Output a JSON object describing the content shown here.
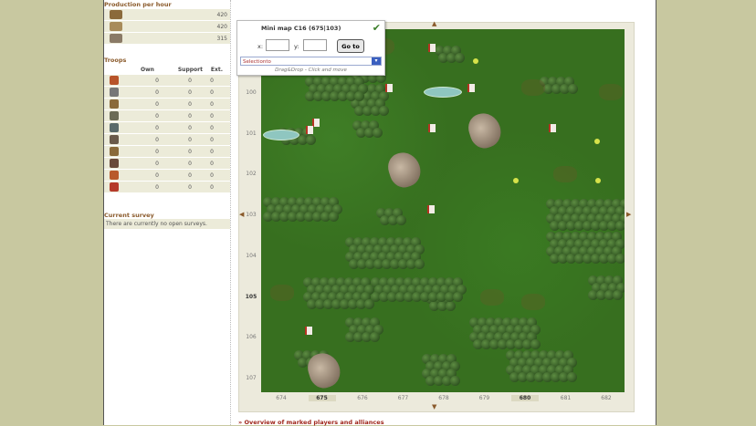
{
  "sidebar": {
    "production_title": "Production per hour",
    "resources": [
      {
        "icon": "wood-icon",
        "color": "#8b6a3b",
        "value": "420"
      },
      {
        "icon": "stone-icon",
        "color": "#a88b5a",
        "value": "420"
      },
      {
        "icon": "iron-icon",
        "color": "#8a7a66",
        "value": "315"
      }
    ],
    "troops_title": "Troops",
    "troop_columns": [
      "Own",
      "Support",
      "Ext."
    ],
    "troops": [
      {
        "icon": "spear-icon",
        "own": "0",
        "support": "0",
        "ext": "0"
      },
      {
        "icon": "sword-icon",
        "own": "0",
        "support": "0",
        "ext": "0"
      },
      {
        "icon": "axe-icon",
        "own": "0",
        "support": "0",
        "ext": "0"
      },
      {
        "icon": "archer-icon",
        "own": "0",
        "support": "0",
        "ext": "0"
      },
      {
        "icon": "scout-icon",
        "own": "0",
        "support": "0",
        "ext": "0"
      },
      {
        "icon": "light-cavalry-icon",
        "own": "0",
        "support": "0",
        "ext": "0"
      },
      {
        "icon": "ram-icon",
        "own": "0",
        "support": "0",
        "ext": "0"
      },
      {
        "icon": "catapult-icon",
        "own": "0",
        "support": "0",
        "ext": "0"
      },
      {
        "icon": "paladin-icon",
        "own": "0",
        "support": "0",
        "ext": "0"
      },
      {
        "icon": "noble-icon",
        "own": "0",
        "support": "0",
        "ext": "0"
      }
    ],
    "survey_title": "Current survey",
    "survey_text": "There are currently no open surveys."
  },
  "minimap": {
    "title": "Mini map C16  (675|103)",
    "x_label": "x:",
    "y_label": "y:",
    "x_value": "",
    "y_value": "",
    "goto_label": "Go to",
    "select_value": "Selectionto",
    "drag_hint": "Drag&Drop - Click and move"
  },
  "map": {
    "y_labels": [
      "100",
      "101",
      "102",
      "103",
      "104",
      "105",
      "106",
      "107"
    ],
    "y_current": "105",
    "x_labels": [
      "674",
      "675",
      "676",
      "677",
      "678",
      "679",
      "680",
      "681",
      "682"
    ],
    "x_current": [
      "675",
      "680"
    ]
  },
  "footer": {
    "overview_link": "» Overview of marked players and alliances"
  }
}
